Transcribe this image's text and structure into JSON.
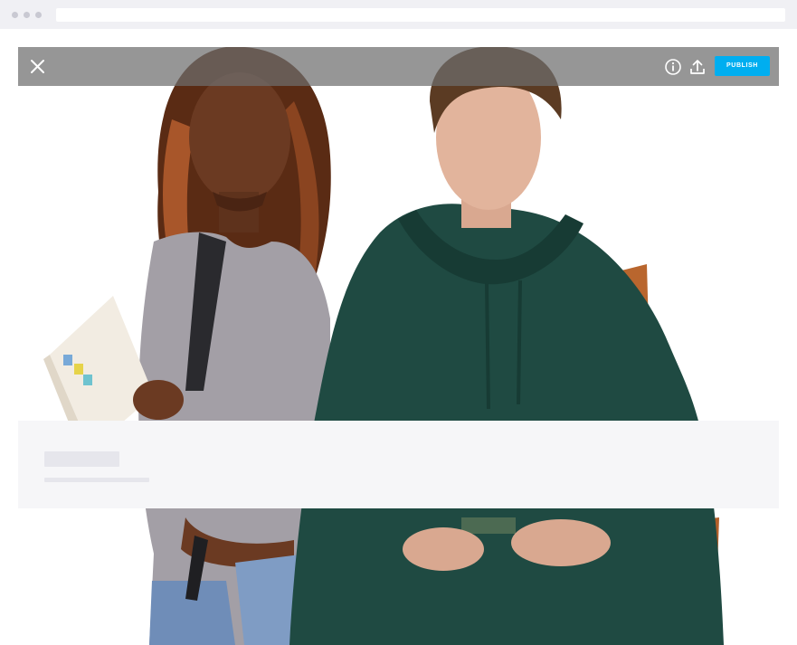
{
  "toolbar": {
    "close_icon": "close-icon",
    "info_icon": "info-icon",
    "upload_icon": "upload-icon",
    "publish_label": "PUBLISH",
    "publish_color": "#00aef0"
  },
  "photo": {
    "subject_icon": "photo-two-students"
  },
  "colors": {
    "toolbar_bg": "#6e6e6e",
    "panel_bg": "#f6f6f8",
    "skeleton": "#e6e6ec"
  }
}
